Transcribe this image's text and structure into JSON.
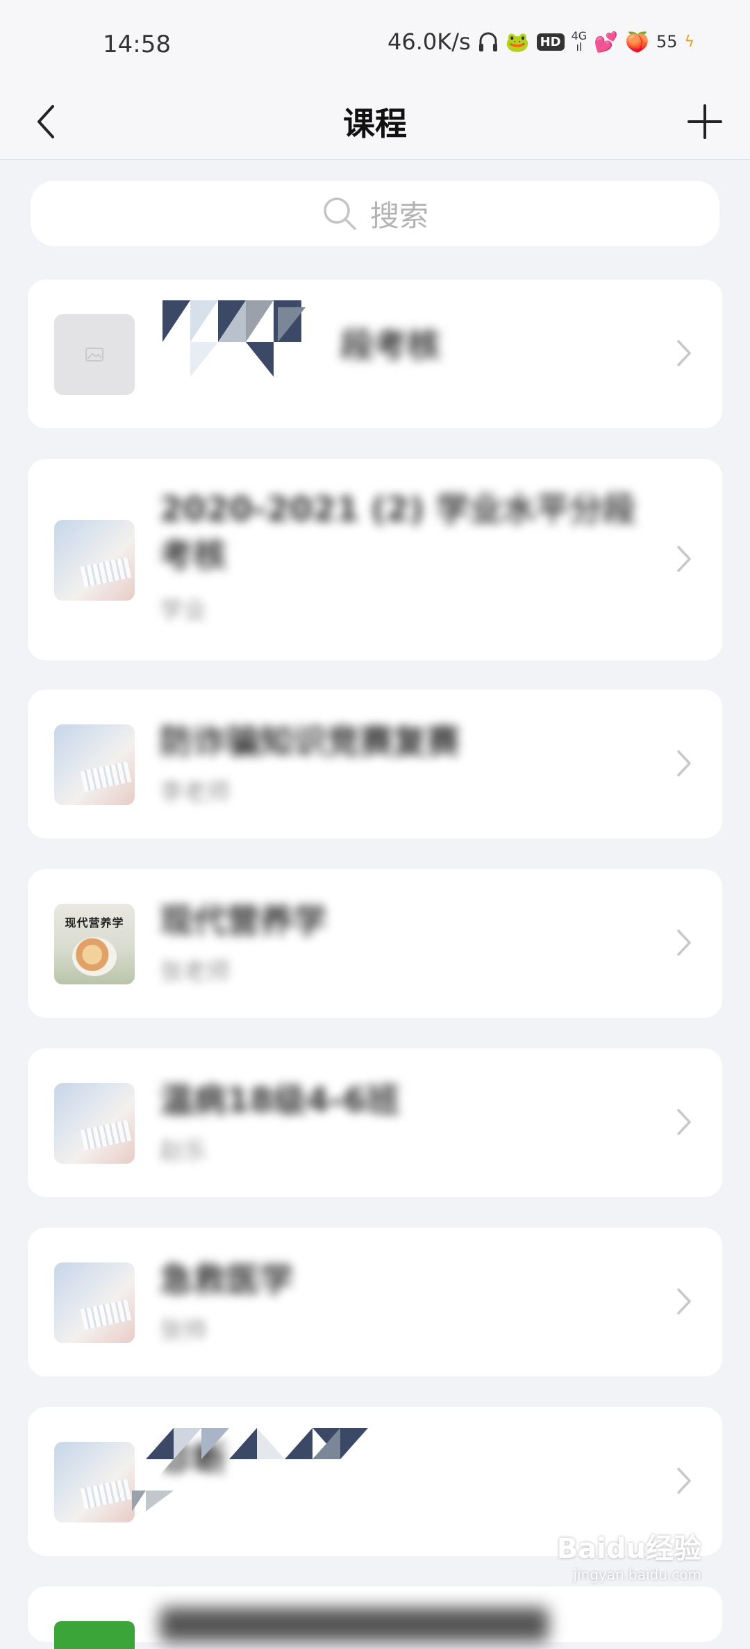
{
  "status_bar": {
    "time": "14:58",
    "net_speed": "46.0K/s",
    "hd_label": "HD",
    "signal_label": "4G",
    "battery": "55"
  },
  "nav": {
    "title": "课程"
  },
  "search": {
    "placeholder": "搜索"
  },
  "courses": [
    {
      "title": "段考核",
      "subtitle": "",
      "thumb": "placeholder"
    },
    {
      "title": "2020-2021 (2) 学业水平分段考核",
      "subtitle": "学业",
      "thumb": "desk"
    },
    {
      "title": "防诈骗知识竞赛复赛",
      "subtitle": "李老师",
      "thumb": "desk"
    },
    {
      "title": "现代营养学",
      "subtitle": "张老师",
      "thumb": "book",
      "thumb_text": "现代营养学"
    },
    {
      "title": "温病18级4-6班",
      "subtitle": "赵乐",
      "thumb": "desk"
    },
    {
      "title": "急救医学",
      "subtitle": "张帅",
      "thumb": "desk"
    },
    {
      "title": "诊断",
      "subtitle": "",
      "thumb": "desk"
    }
  ],
  "watermark": {
    "brand": "Baidu经验",
    "url": "jingyan.baidu.com"
  },
  "colors": {
    "background": "#f2f3f7",
    "card": "#ffffff",
    "accent_green": "#3ca53a"
  }
}
